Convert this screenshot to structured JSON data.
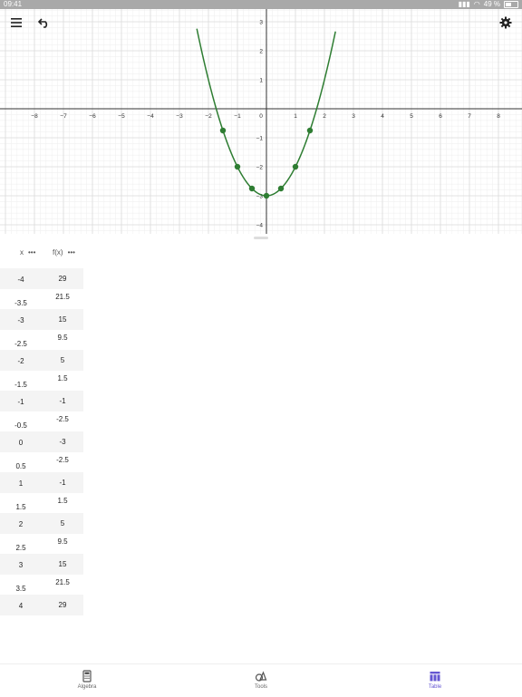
{
  "status": {
    "time": "09:41",
    "battery": "49 %"
  },
  "toolbar": {
    "menu": "menu-icon",
    "undo": "undo-icon",
    "settings": "gear-icon"
  },
  "graph": {
    "function": "x^2 - 3",
    "x_ticks": [
      "−8",
      "−7",
      "−6",
      "−5",
      "−4",
      "−3",
      "−2",
      "−1",
      "0",
      "1",
      "2",
      "3",
      "4",
      "5",
      "6",
      "7",
      "8"
    ],
    "y_ticks": [
      "3",
      "2",
      "1",
      "−1",
      "−2",
      "−3",
      "−4"
    ],
    "curve_color": "#2e7d32",
    "points": [
      [
        -1.5,
        -0.75
      ],
      [
        -1,
        -2
      ],
      [
        -0.5,
        -2.75
      ],
      [
        0,
        -3
      ],
      [
        0.5,
        -2.75
      ],
      [
        1,
        -2
      ],
      [
        1.5,
        -0.75
      ]
    ]
  },
  "table": {
    "col_x": "x",
    "col_y": "f(x)",
    "rows": [
      {
        "x": "-4",
        "y": "29"
      },
      {
        "x": "-3.5",
        "y": "21.5"
      },
      {
        "x": "-3",
        "y": "15"
      },
      {
        "x": "-2.5",
        "y": "9.5"
      },
      {
        "x": "-2",
        "y": "5"
      },
      {
        "x": "-1.5",
        "y": "1.5"
      },
      {
        "x": "-1",
        "y": "-1"
      },
      {
        "x": "-0.5",
        "y": "-2.5"
      },
      {
        "x": "0",
        "y": "-3"
      },
      {
        "x": "0.5",
        "y": "-2.5"
      },
      {
        "x": "1",
        "y": "-1"
      },
      {
        "x": "1.5",
        "y": "1.5"
      },
      {
        "x": "2",
        "y": "5"
      },
      {
        "x": "2.5",
        "y": "9.5"
      },
      {
        "x": "3",
        "y": "15"
      },
      {
        "x": "3.5",
        "y": "21.5"
      },
      {
        "x": "4",
        "y": "29"
      }
    ]
  },
  "nav": {
    "algebra": "Algebra",
    "tools": "Tools",
    "table": "Table",
    "active_color": "#6557d2"
  }
}
